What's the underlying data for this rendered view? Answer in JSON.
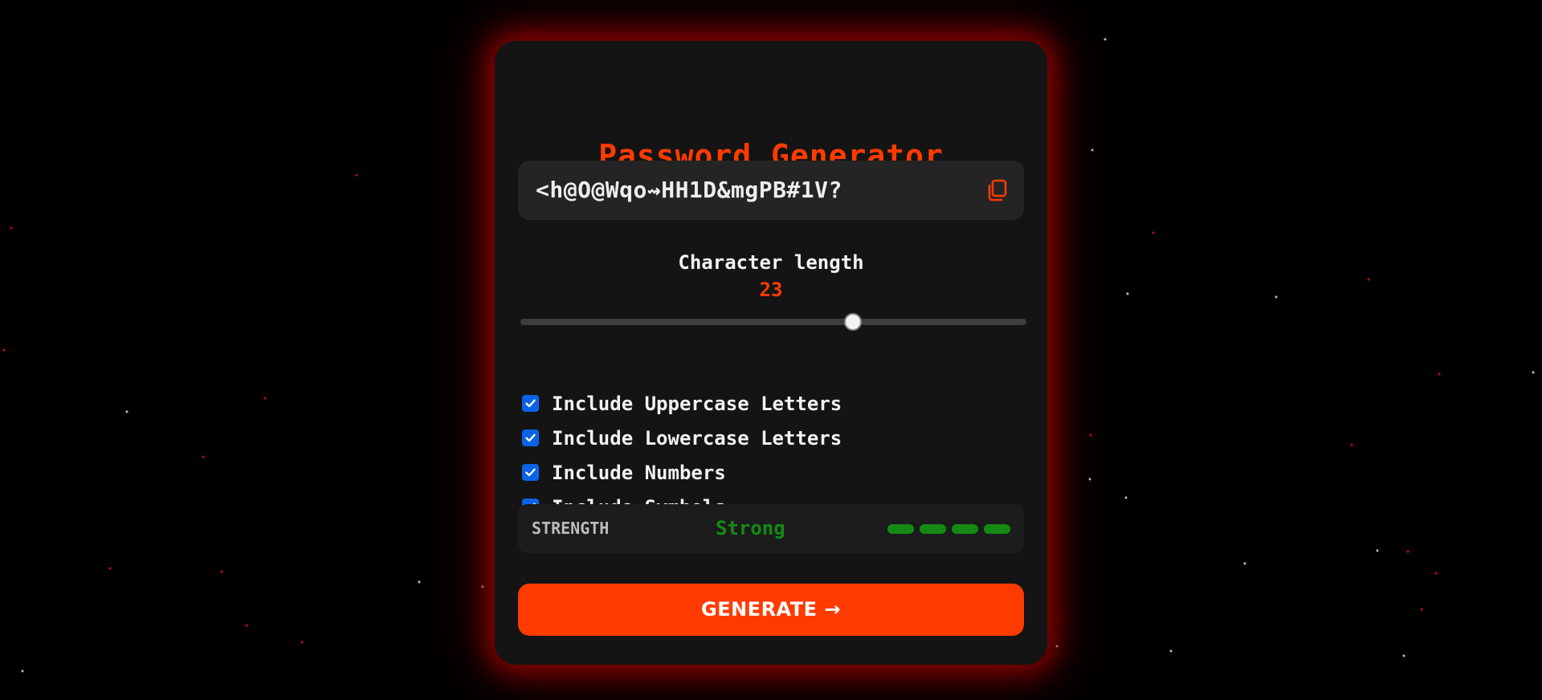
{
  "app": {
    "title": "Password Generator"
  },
  "password": {
    "value": "<h@O@Wqo⇝HH1D&mgPB#1V?"
  },
  "copy": {
    "icon": "copy-icon"
  },
  "length": {
    "label": "Character length",
    "value": "23",
    "min": 0,
    "max": 35
  },
  "options": [
    {
      "label": "Include Uppercase Letters",
      "checked": true
    },
    {
      "label": "Include Lowercase Letters",
      "checked": true
    },
    {
      "label": "Include Numbers",
      "checked": true
    },
    {
      "label": "Include Symbols",
      "checked": true
    }
  ],
  "strength": {
    "label": "STRENGTH",
    "value": "Strong",
    "level": 4,
    "max_level": 4
  },
  "generate": {
    "label": "GENERATE →"
  },
  "colors": {
    "accent": "#ff3b00",
    "strength_good": "#148a14",
    "checkbox": "#0b63e6",
    "glow": "#aa0000"
  }
}
